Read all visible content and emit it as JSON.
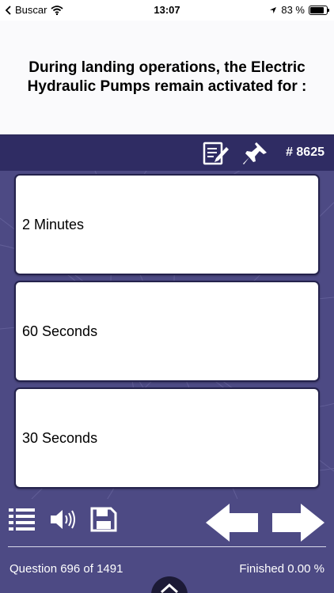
{
  "status": {
    "carrier": "Buscar",
    "time": "13:07",
    "battery_text": "83 %",
    "battery_level": 0.83
  },
  "question": {
    "text": "During landing operations, the Electric Hydraulic Pumps remain activated for :"
  },
  "toolbar": {
    "question_number": "# 8625"
  },
  "answers": [
    {
      "label": "2 Minutes"
    },
    {
      "label": "60 Seconds"
    },
    {
      "label": "30 Seconds"
    }
  ],
  "footer": {
    "progress_text": "Question 696 of 1491",
    "finished_text": "Finished 0.00 %"
  },
  "colors": {
    "header": "#2f2c63",
    "background": "#4d4a84",
    "card": "#ffffff"
  }
}
